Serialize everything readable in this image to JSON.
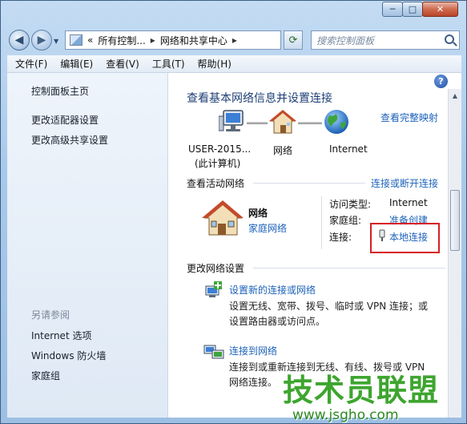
{
  "window": {
    "min_label": "─",
    "max_label": "□",
    "close_label": "✕"
  },
  "nav": {
    "back_glyph": "◀",
    "fwd_glyph": "▶",
    "dropdown_glyph": "▼"
  },
  "address": {
    "chevrons": "«",
    "crumbs": [
      "所有控制...",
      "网络和共享中心"
    ],
    "separator": "▸",
    "dropdown_glyph": "▼"
  },
  "refresh": {
    "glyph": "⟳"
  },
  "search": {
    "placeholder": "搜索控制面板"
  },
  "menu": [
    "文件(F)",
    "编辑(E)",
    "查看(V)",
    "工具(T)",
    "帮助(H)"
  ],
  "sidebar": {
    "links": [
      "控制面板主页",
      "更改适配器设置",
      "更改高级共享设置"
    ],
    "see_also_title": "另请参阅",
    "see_also_links": [
      "Internet 选项",
      "Windows 防火墙",
      "家庭组"
    ]
  },
  "main": {
    "help_glyph": "?",
    "title": "查看基本网络信息并设置连接",
    "full_map_link": "查看完整映射",
    "map_nodes": [
      {
        "line1": "USER-2015...",
        "line2": "(此计算机)"
      },
      {
        "line1": "网络",
        "line2": ""
      },
      {
        "line1": "Internet",
        "line2": ""
      }
    ],
    "active_section": {
      "title": "查看活动网络",
      "connect_link": "连接或断开连接"
    },
    "network": {
      "name": "网络",
      "type_link": "家庭网络"
    },
    "props": [
      {
        "label": "访问类型:",
        "value": "Internet"
      },
      {
        "label": "家庭组:",
        "value": "准备创建"
      },
      {
        "label": "连接:",
        "value": "本地连接"
      }
    ],
    "change_section": {
      "title": "更改网络设置"
    },
    "tasks": [
      {
        "title": "设置新的连接或网络",
        "desc": "设置无线、宽带、拨号、临时或 VPN 连接；或设置路由器或访问点。"
      },
      {
        "title": "连接到网络",
        "desc": "连接到或重新连接到无线、有线、拨号或 VPN 网络连接。"
      }
    ]
  },
  "scrollbar": {
    "up_glyph": "▲"
  },
  "watermark": {
    "text": "技术员联盟",
    "url": "www.jsgho.com"
  }
}
